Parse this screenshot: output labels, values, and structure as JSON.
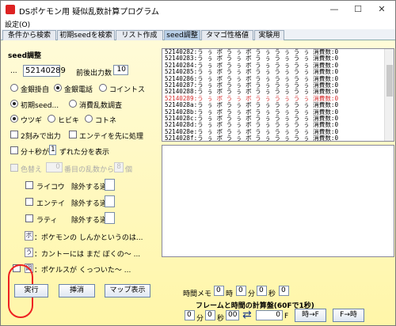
{
  "window": {
    "title": "DSポケモン用 疑似乱数計算プログラム",
    "controls": [
      "—",
      "☐",
      "✕"
    ],
    "menu": "設定(O)"
  },
  "tabs": [
    "条件から検索",
    "初期seedを検索",
    "リスト作成",
    "seed調整",
    "タマゴ性格値",
    "実験用"
  ],
  "seed": {
    "heading": "seed調整",
    "ellipsis": "...",
    "value": "52140289",
    "range_label": "前後出力数",
    "range_value": "10"
  },
  "mode_radios": [
    "金銀掛自",
    "金銀電話",
    "コイントス"
  ],
  "type_radios": [
    "初期seed...",
    "消費乱数調査"
  ],
  "sound_radios": [
    "ウツギ",
    "ヒビキ",
    "コトネ"
  ],
  "checks": {
    "two_steps": "2刻みで出力",
    "entei_first": "エンテイを先に処理",
    "minute_second": "分＋秒が",
    "minute_value": "1",
    "minute_suffix": "ずれた分を表示",
    "color": "色替え",
    "color_value": "0",
    "color_mid": "番目の乱数から",
    "color_count": "8",
    "color_suffix": "個"
  },
  "roamers": [
    {
      "name": "ライコウ",
      "suffix": "除外する道"
    },
    {
      "name": "エンテイ",
      "suffix": "除外する道"
    },
    {
      "name": "ラティ",
      "suffix": "除外する道"
    }
  ],
  "speakers": [
    {
      "box": "ボ",
      "text": "：ポケモンの しんかというのは..."
    },
    {
      "box": "う",
      "text": "：カントーには まだ ぼくの～ ..."
    },
    {
      "box": "図",
      "text": "：ポケルスが くっついた～ ..."
    }
  ],
  "buttons": {
    "run": "実行",
    "clear": "挿消",
    "map": "マップ表示"
  },
  "seed_list": [
    "52140282:う ぅ ボ う ぅ ボ う ぅ う ぅ う ぅ 消費数:0",
    "52140283:う ぅ ボ う ぅ ボ う ぅ う ぅ う ぅ 消費数:0",
    "52140284:う ぅ ボ う ぅ ボ う ぅ う ぅ う ぅ 消費数:0",
    "52140285:う ぅ ボ う ぅ ボ う ぅ う ぅ う ぅ 消費数:0",
    "52140286:う ぅ ボ う ぅ ボ う ぅ う ぅ う ぅ 消費数:0",
    "52140287:う ぅ ボ う ぅ ボ う ぅ う ぅ う ぅ 消費数:0",
    "52140288:う ぅ ボ う ぅ ボ う ぅ う ぅ う ぅ 消費数:0",
    "52140289:う ぅ ボ う ぅ ボ う ぅ う ぅ う ぅ 消費数:0",
    "5214028a:う ぅ ボ う ぅ ボ う ぅ う ぅ う ぅ 消費数:0",
    "5214028b:う ぅ ボ う ぅ ボ う ぅ う ぅ う ぅ 消費数:0",
    "5214028c:う ぅ ボ う ぅ ボ う ぅ う ぅ う ぅ 消費数:0",
    "5214028d:う ぅ ボ う ぅ ボ う ぅ う ぅ う ぅ 消費数:0",
    "5214028e:う ぅ ボ う ぅ ボ う ぅ う ぅ う ぅ 消費数:0",
    "5214028f:う ぅ ボ う ぅ ボ う ぅ う ぅ う ぅ 消費数:0",
    "52140290:う ぅ ボ う ぅ ボ う ぅ う ぅ う ぅ 消費数:0"
  ],
  "highlight_index": 7,
  "highlight_color": "#d42b2b",
  "time_memo": {
    "label": "時間メモ",
    "hour": "0",
    "hour_unit": "時",
    "minute": "0",
    "minute_unit": "分",
    "second": "0",
    "second_unit": "秒",
    "extra": "0"
  },
  "calc": {
    "heading": "フレームと時間の計算盤(60Fで1秒)",
    "min": "0",
    "min_unit": "分",
    "sec": "0",
    "sec_unit": "秒",
    "ms": "00",
    "swap_icon": "⇄",
    "frames": "0",
    "frames_unit": "F",
    "to_frame": "時→F",
    "to_time": "F→時"
  },
  "accent_color": "#e22222"
}
